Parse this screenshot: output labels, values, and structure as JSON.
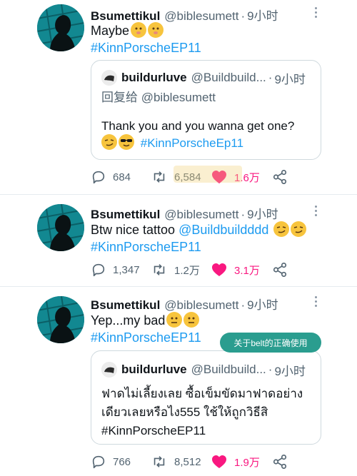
{
  "tweets": [
    {
      "name": "Bsumettikul",
      "handle": "@biblesumett",
      "time": "9小时",
      "text": "Maybe",
      "hashtag": "#KinnPorscheEP11",
      "emoji": [
        "shushing-face",
        "shushing-face"
      ],
      "quote": {
        "name": "buildurluve",
        "handle": "@Buildbuild...",
        "time": "9小时",
        "reply_to": "回复给 @biblesumett",
        "text": "Thank you and you wanna get one?",
        "emoji": [
          "smirking-face",
          "sunglasses-face"
        ],
        "hashtag": "#KinnPorscheEp11"
      },
      "stats": {
        "replies": "684",
        "retweets": "6,584",
        "likes": "1.6万"
      }
    },
    {
      "name": "Bsumettikul",
      "handle": "@biblesumett",
      "time": "9小时",
      "text": "Btw nice tattoo ",
      "mention": "@Buildbuildddd",
      "emoji": [
        "smirking-face",
        "smirking-face"
      ],
      "hashtag": "#KinnPorscheEP11",
      "stats": {
        "replies": "1,347",
        "retweets": "1.2万",
        "likes": "3.1万"
      }
    },
    {
      "name": "Bsumettikul",
      "handle": "@biblesumett",
      "time": "9小时",
      "text": "Yep...my bad",
      "emoji": [
        "neutral-face",
        "neutral-face"
      ],
      "hashtag": "#KinnPorscheEP11",
      "quote": {
        "name": "buildurluve",
        "handle": "@Buildbuild...",
        "time": "9小时",
        "line1": "ฟาดไม่เลี้ยงเลย ซื้อเข็มขัดมาฟาดอย่าง",
        "line2": "เดียวเลยหรือไง555 ใช้ให้ถูกวิธีสิ",
        "hashtag": "#KinnPorscheEP11"
      },
      "stats": {
        "replies": "766",
        "retweets": "8,512",
        "likes": "1.9万"
      }
    }
  ],
  "tooltip": "关于belt的正确使用",
  "colors": {
    "link": "#1d9bf0",
    "like": "#f91880",
    "muted": "#536471",
    "tooltip_bg": "#2a9d8f"
  }
}
